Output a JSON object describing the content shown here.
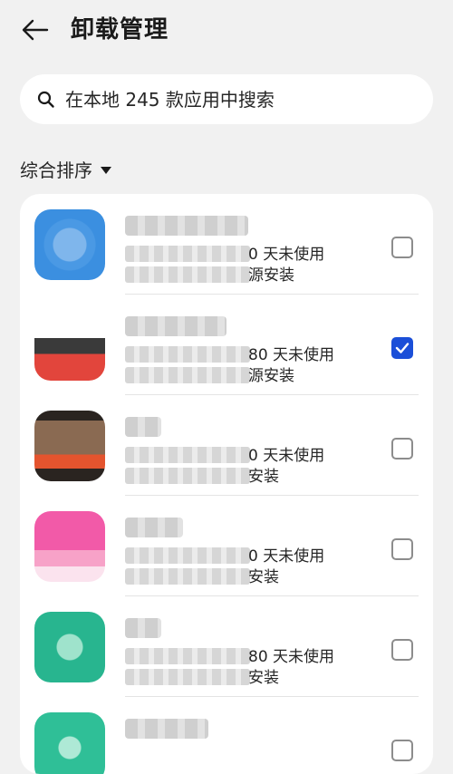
{
  "header": {
    "back_icon": "arrow-left-icon",
    "title": "卸载管理"
  },
  "search": {
    "icon": "search-icon",
    "placeholder": "在本地 245 款应用中搜索"
  },
  "sort": {
    "label": "综合排序",
    "caret_icon": "caret-down-icon"
  },
  "apps": [
    {
      "unused_label": "0 天未使用",
      "source_label": "源安装",
      "checked": false,
      "icon_color": "#3b8fe0"
    },
    {
      "unused_label": "80 天未使用",
      "source_label": "源安装",
      "checked": true,
      "icon_color": "#d8433a"
    },
    {
      "unused_label": "0 天未使用",
      "source_label": "安装",
      "checked": false,
      "icon_color": "#6a4b3c"
    },
    {
      "unused_label": "0 天未使用",
      "source_label": "安装",
      "checked": false,
      "icon_color": "#e9479a"
    },
    {
      "unused_label": "80 天未使用",
      "source_label": "安装",
      "checked": false,
      "icon_color": "#28b58f"
    },
    {
      "unused_label": "",
      "source_label": "",
      "checked": false,
      "icon_color": "#2fbf97"
    }
  ],
  "colors": {
    "background": "#f1f1f1",
    "card": "#ffffff",
    "accent": "#1b4fd8"
  }
}
